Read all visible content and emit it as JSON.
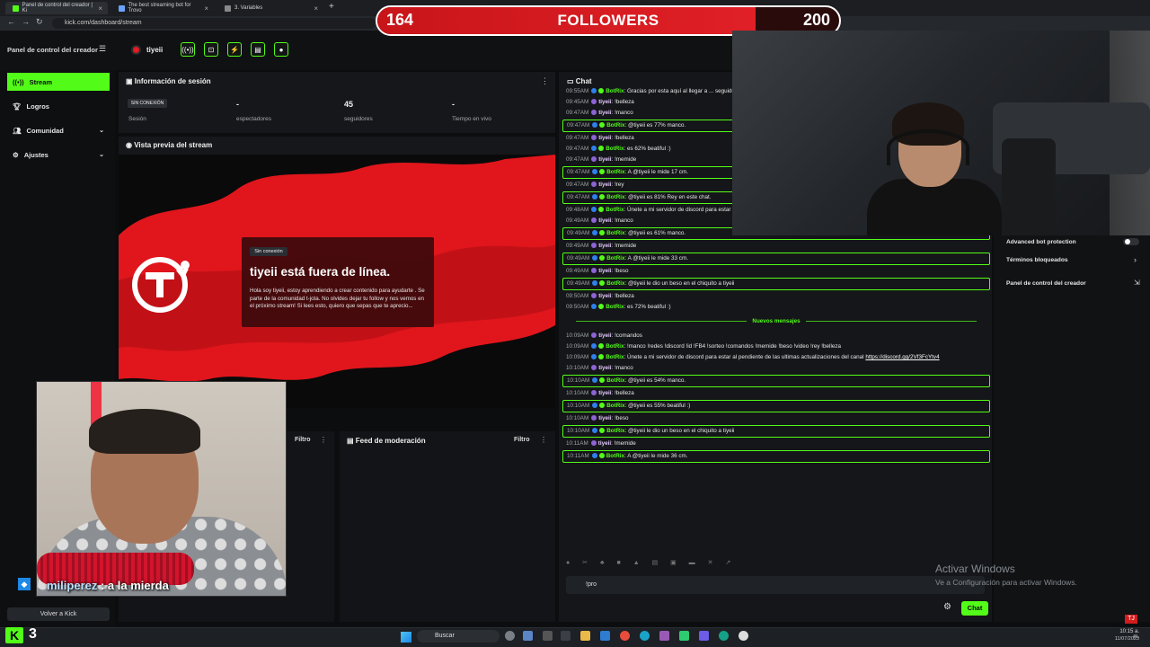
{
  "browser": {
    "tabs": [
      {
        "label": "Panel de control del creador | Ki"
      },
      {
        "label": "The best streaming bot for Trovo"
      },
      {
        "label": "3. Variables"
      }
    ],
    "url": "kick.com/dashboard/stream"
  },
  "follower_goal": {
    "current": "164",
    "label": "FOLLOWERS",
    "goal": "200",
    "progress": 0.82
  },
  "header": {
    "panel_title": "Panel de control del creador",
    "channel": "tiyeii"
  },
  "sidebar": {
    "items": [
      {
        "label": "Stream",
        "icon": "broadcast-icon"
      },
      {
        "label": "Logros",
        "icon": "trophy-icon"
      },
      {
        "label": "Comunidad",
        "icon": "users-icon"
      },
      {
        "label": "Ajustes",
        "icon": "gear-icon"
      }
    ],
    "back": "Volver a Kick"
  },
  "session": {
    "title": "Información de sesión",
    "badge": "SIN CONEXIÓN",
    "stats": [
      {
        "value": "",
        "label": "Sesión"
      },
      {
        "value": "-",
        "label": "espectadores"
      },
      {
        "value": "45",
        "label": "seguidores"
      },
      {
        "value": "-",
        "label": "Tiempo en vivo"
      }
    ]
  },
  "preview": {
    "title": "Vista previa del stream",
    "badge": "Sin conexión",
    "offline_title": "tiyeii está fuera de línea.",
    "offline_desc": "Hola soy tiyeii, estoy aprendiendo a crear contenido para ayudarte . Se parte de la comunidad t-jota. No olvides dejar tu follow y nos vemos en el próximo stream! Si lees esto, quiero que sepas que te aprecio..."
  },
  "feeds": {
    "left_filter": "Filtro",
    "mod_title": "Feed de moderación",
    "mod_filter": "Filtro"
  },
  "chat": {
    "title": "Chat",
    "messages": [
      {
        "time": "09:55AM",
        "user": "BotRix",
        "bot": true,
        "hl": false,
        "text": "Gracias por esta aquí al llegar a ... seguidor entrar al discord"
      },
      {
        "time": "09:45AM",
        "user": "tiyeii",
        "bot": false,
        "hl": false,
        "text": "!belleza"
      },
      {
        "time": "09:47AM",
        "user": "tiyeii",
        "bot": false,
        "hl": false,
        "text": "!manco"
      },
      {
        "time": "09:47AM",
        "user": "BotRix",
        "bot": true,
        "hl": true,
        "text": "@tiyeii es 77% manco."
      },
      {
        "time": "09:47AM",
        "user": "tiyeii",
        "bot": false,
        "hl": false,
        "text": "!belleza"
      },
      {
        "time": "09:47AM",
        "user": "BotRix",
        "bot": true,
        "hl": false,
        "text": "es 62% beatiful :)"
      },
      {
        "time": "09:47AM",
        "user": "tiyeii",
        "bot": false,
        "hl": false,
        "text": "!memide"
      },
      {
        "time": "09:47AM",
        "user": "BotRix",
        "bot": true,
        "hl": true,
        "text": "A @tiyeii le mide 17 cm."
      },
      {
        "time": "09:47AM",
        "user": "tiyeii",
        "bot": false,
        "hl": false,
        "text": "!rey"
      },
      {
        "time": "09:47AM",
        "user": "BotRix",
        "bot": true,
        "hl": true,
        "text": "@tiyeii es 81% Rey en este chat."
      },
      {
        "time": "09:48AM",
        "user": "BotRix",
        "bot": true,
        "hl": false,
        "text": "Únete a mi servidor de discord para estar al pendiente de las ultimas actualizaciones del canal ",
        "link": "https://discord.gg/2Vf3FcYtv4"
      },
      {
        "time": "09:49AM",
        "user": "tiyeii",
        "bot": false,
        "hl": false,
        "text": "!manco"
      },
      {
        "time": "09:49AM",
        "user": "BotRix",
        "bot": true,
        "hl": true,
        "text": "@tiyeii es 61% manco."
      },
      {
        "time": "09:49AM",
        "user": "tiyeii",
        "bot": false,
        "hl": false,
        "text": "!memide"
      },
      {
        "time": "09:49AM",
        "user": "BotRix",
        "bot": true,
        "hl": true,
        "text": "A @tiyeii le mide 33 cm."
      },
      {
        "time": "09:49AM",
        "user": "tiyeii",
        "bot": false,
        "hl": false,
        "text": "!beso"
      },
      {
        "time": "09:49AM",
        "user": "BotRix",
        "bot": true,
        "hl": true,
        "text": "@tiyeii le dio un beso en el chiquito a tiyeii"
      },
      {
        "time": "09:50AM",
        "user": "tiyeii",
        "bot": false,
        "hl": false,
        "text": "!belleza"
      },
      {
        "time": "09:50AM",
        "user": "BotRix",
        "bot": true,
        "hl": false,
        "text": "es 72% beatiful :)"
      },
      {
        "separator": true,
        "text": "Nuevos mensajes"
      },
      {
        "time": "10:09AM",
        "user": "tiyeii",
        "bot": false,
        "hl": false,
        "text": "!comandos"
      },
      {
        "time": "10:09AM",
        "user": "BotRix",
        "bot": true,
        "hl": false,
        "text": "!manco !redes !discord !id !FB4 !sorteo !comandos !memide !beso !video !rey !belleza"
      },
      {
        "time": "10:09AM",
        "user": "BotRix",
        "bot": true,
        "hl": false,
        "text": "Únete a mi servidor de discord para estar al pendiente de las ultimas actualizaciones del canal ",
        "link": "https://discord.gg/2Vf3FcYtv4"
      },
      {
        "time": "10:10AM",
        "user": "tiyeii",
        "bot": false,
        "hl": false,
        "text": "!manco"
      },
      {
        "time": "10:10AM",
        "user": "BotRix",
        "bot": true,
        "hl": true,
        "text": "@tiyeii es 54% manco."
      },
      {
        "time": "10:10AM",
        "user": "tiyeii",
        "bot": false,
        "hl": false,
        "text": "!belleza"
      },
      {
        "time": "10:10AM",
        "user": "BotRix",
        "bot": true,
        "hl": true,
        "text": "@tiyeii es 55% beatiful :)"
      },
      {
        "time": "10:10AM",
        "user": "tiyeii",
        "bot": false,
        "hl": false,
        "text": "!beso"
      },
      {
        "time": "10:10AM",
        "user": "BotRix",
        "bot": true,
        "hl": true,
        "text": "@tiyeii le dio un beso en el chiquito a tiyeii"
      },
      {
        "time": "10:11AM",
        "user": "tiyeii",
        "bot": false,
        "hl": false,
        "text": "!memide"
      },
      {
        "time": "10:11AM",
        "user": "BotRix",
        "bot": true,
        "hl": true,
        "text": "A @tiyeii le mide 36 cm."
      }
    ],
    "input_value": "!pro",
    "send_label": "Chat"
  },
  "right_panel": {
    "items": [
      {
        "label": "Advanced bot protection"
      },
      {
        "label": "Términos bloqueados"
      },
      {
        "label": "Panel de control del creador"
      }
    ]
  },
  "overlay": {
    "user": "miliperez",
    "text": ": a la mierda"
  },
  "kick_badge": {
    "letter": "K",
    "count": "3"
  },
  "windows": {
    "activate_title": "Activar Windows",
    "activate_sub": "Ve a Configuración para activar Windows."
  },
  "taskbar": {
    "search": "Buscar",
    "time": "10:15 a. m.",
    "date": "11/07/2023"
  },
  "colors": {
    "accent": "#53fc18",
    "offline_red": "#e01c25",
    "panel": "#15171a"
  }
}
